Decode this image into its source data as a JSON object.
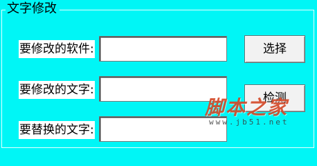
{
  "group": {
    "title": "文字修改"
  },
  "fields": [
    {
      "label": "要修改的软件:",
      "value": "",
      "placeholder": ""
    },
    {
      "label": "要修改的文字:",
      "value": "",
      "placeholder": ""
    },
    {
      "label": "要替换的文字:",
      "value": "",
      "placeholder": ""
    }
  ],
  "buttons": {
    "select_label": "选择",
    "detect_label": "检测"
  },
  "watermark": {
    "title": "脚本之家",
    "url": "www.jb51.net"
  },
  "colors": {
    "background": "#00f6f6",
    "field_label_bg": "#ffffff",
    "watermark_red": "#d44a2a"
  }
}
